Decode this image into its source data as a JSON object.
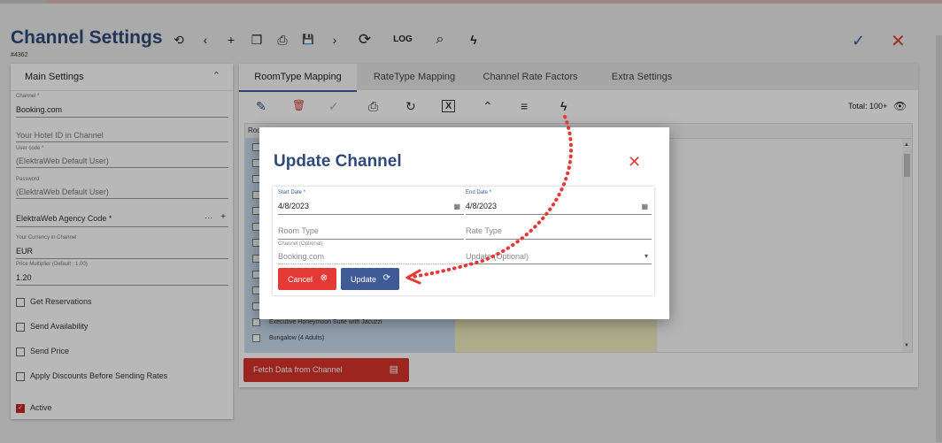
{
  "header": {
    "title": "Channel Settings",
    "record_id": "#4362",
    "toolbar": {
      "history": "⟲",
      "prev": "‹",
      "add": "+",
      "copy": "❐",
      "print": "⎙",
      "save": "💾",
      "next": "›",
      "refresh": "⟳",
      "log": "LOG",
      "search": "⌕",
      "flash": "ϟ"
    },
    "confirm": "✓",
    "close": "✕"
  },
  "left_panel": {
    "title": "Main Settings",
    "collapse_icon": "⌃",
    "channel_label": "Channel *",
    "channel_value": "Booking.com",
    "hotel_id_placeholder": "Your Hotel ID in Channel",
    "user_code_label": "User code *",
    "user_code_value": "(ElektraWeb Default User)",
    "password_label": "Password",
    "password_value": "(ElektraWeb Default User)",
    "agency_code_placeholder": "ElektraWeb Agency Code *",
    "agency_dots": "···",
    "agency_plus": "+",
    "currency_label": "Your Currency in Channel",
    "currency_value": "EUR",
    "multiplier_label": "Price Multiplier (Default : 1.00)",
    "multiplier_value": "1.20",
    "checkboxes": [
      {
        "label": "Get Reservations",
        "checked": false
      },
      {
        "label": "Send Availability",
        "checked": false
      },
      {
        "label": "Send Price",
        "checked": false
      },
      {
        "label": "Apply Discounts Before Sending Rates",
        "checked": false
      },
      {
        "label": "Active",
        "checked": true
      }
    ]
  },
  "tabs": [
    "RoomType Mapping",
    "RateType Mapping",
    "Channel Rate Factors",
    "Extra Settings"
  ],
  "grid_toolbar": {
    "edit": "✎",
    "delete": "🗑",
    "check": "✓",
    "print": "⎙",
    "refresh": "↻",
    "excel": "X",
    "collapse": "⌃",
    "menu": "≡",
    "flash": "ϟ",
    "total": "Total: 100+",
    "eye": "👁"
  },
  "grid": {
    "header": "Roo",
    "rows": [
      "Executive Honeymoon Suite with Jacuzzi",
      "Bungalow (4 Adults)"
    ],
    "scroll_up": "▲",
    "scroll_down": "▼"
  },
  "fetch_button": {
    "label": "Fetch Data from Channel",
    "icon": "▤"
  },
  "modal": {
    "title": "Update Channel",
    "close": "✕",
    "start_date_label": "Start Date *",
    "start_date_value": "4/8/2023",
    "end_date_label": "End Date *",
    "end_date_value": "4/8/2023",
    "calendar_icon": "▦",
    "room_type_placeholder": "Room Type",
    "rate_type_placeholder": "Rate Type",
    "channel_label": "Channel (Optional)",
    "channel_value": "Booking.com",
    "update_placeholder": "Update (Optional)",
    "dropdown_icon": "▾",
    "cancel_label": "Cancel",
    "cancel_icon": "⊗",
    "update_label": "Update",
    "update_icon": "⟳"
  },
  "colors": {
    "title": "#2f4a7a",
    "accent_red": "#d9433a",
    "button_blue": "#3e5a97",
    "annotation_arrow": "#e53935"
  }
}
